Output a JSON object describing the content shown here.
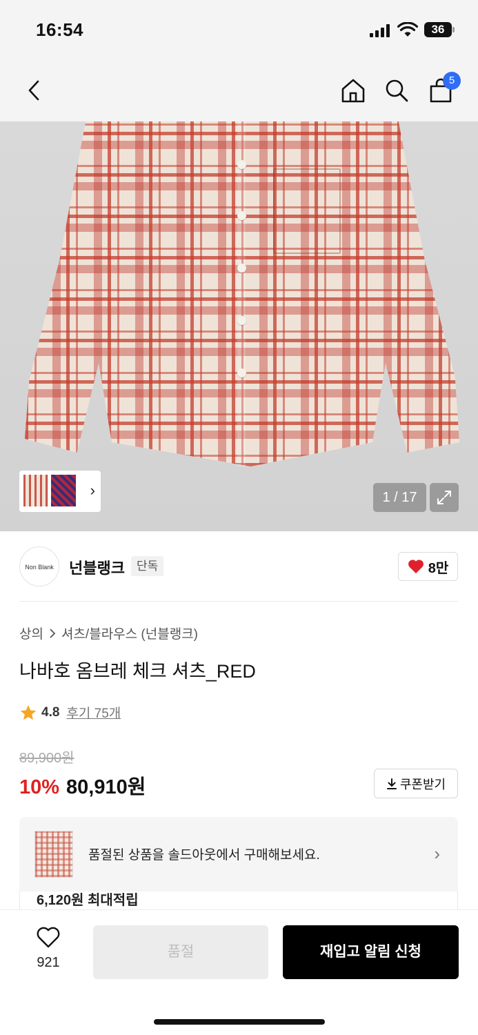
{
  "status_bar": {
    "time": "16:54",
    "battery": "36"
  },
  "nav": {
    "cart_count": "5",
    "icons": [
      "back-icon",
      "home-icon",
      "search-icon",
      "shopping-bag-icon"
    ]
  },
  "gallery": {
    "page_indicator": "1 / 17"
  },
  "brand": {
    "logo_text": "Non Blank",
    "name": "넌블랭크",
    "tag": "단독",
    "likes": "8만"
  },
  "breadcrumb": {
    "category": "상의",
    "subcategory": "셔츠/블라우스 (넌블랭크)"
  },
  "product": {
    "title": "나바호 옴브레 체크 셔츠_RED"
  },
  "rating": {
    "value": "4.8",
    "reviews": "후기 75개"
  },
  "price": {
    "original": "89,900원",
    "discount": "10%",
    "final": "80,910원"
  },
  "coupon": {
    "label": "쿠폰받기"
  },
  "soldout_banner": {
    "text": "품절된 상품을 솔드아웃에서 구매해보세요."
  },
  "points": {
    "text": "6,120원 최대적립"
  },
  "bottom_bar": {
    "wish_count": "921",
    "soldout_label": "품절",
    "restock_label": "재입고 알림 신청"
  },
  "colors": {
    "discount": "#e02020",
    "badge": "#2f6df6",
    "heart": "#e0202c",
    "primary_button": "#000000"
  }
}
